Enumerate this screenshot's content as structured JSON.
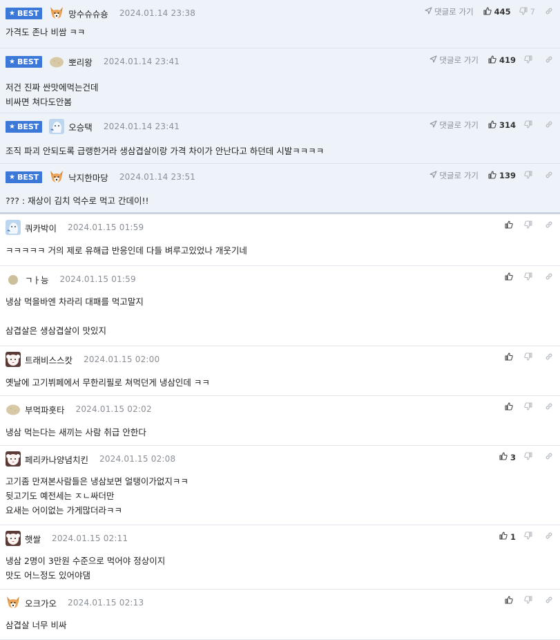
{
  "labels": {
    "best": "BEST",
    "goto": "댓글로 가기"
  },
  "colors": {
    "best_bg": "#eef3f9",
    "best_badge": "#3c78d8",
    "muted": "#8a8f96"
  },
  "comments": [
    {
      "best": true,
      "avatar": "shiba",
      "nick": "망수슈슈숑",
      "date": "2024.01.14 23:38",
      "likes": "445",
      "dislikes": "7",
      "text": "가격도 존나 비쌈 ㅋㅋ"
    },
    {
      "best": true,
      "avatar": "potato",
      "nick": "뽀리왕",
      "date": "2024.01.14 23:41",
      "likes": "419",
      "dislikes": "",
      "text": "저건 진짜 싼맛에먹는건데\n비싸면 쳐다도안봄"
    },
    {
      "best": true,
      "avatar": "ghost",
      "nick": "오승택",
      "date": "2024.01.14 23:41",
      "likes": "314",
      "dislikes": "",
      "text": "조직 파괴 안되도록 급랭한거라 생삼겹살이랑 가격 차이가 안난다고 하던데 시발ㅋㅋㅋㅋ"
    },
    {
      "best": true,
      "avatar": "shiba",
      "nick": "낙지한마당",
      "date": "2024.01.14 23:51",
      "likes": "139",
      "dislikes": "",
      "text": "??? : 재상이 김치 억수로 먹고 간데이!!"
    },
    {
      "best": false,
      "avatar": "ghost",
      "nick": "쿼카박이",
      "date": "2024.01.15 01:59",
      "likes": "",
      "dislikes": "",
      "text": "ㅋㅋㅋㅋㅋ 거의 제로 유해급 반응인데 다들 벼루고있었나 개웃기네"
    },
    {
      "best": false,
      "avatar": "potato-small",
      "nick": "ㄱㅏ능",
      "date": "2024.01.15 01:59",
      "likes": "",
      "dislikes": "",
      "text": "냉삼 먹을바엔 차라리 대패를 먹고말지\n\n삼겹살은 생삼겹살이 맛있지"
    },
    {
      "best": false,
      "avatar": "dog",
      "nick": "트래비스스캇",
      "date": "2024.01.15 02:00",
      "likes": "",
      "dislikes": "",
      "text": "옛날에 고기뷔페에서 무한리필로 쳐먹던게 냉삼인데 ㅋㅋ"
    },
    {
      "best": false,
      "avatar": "potato",
      "nick": "부먹파훗타",
      "date": "2024.01.15 02:02",
      "likes": "",
      "dislikes": "",
      "text": "냉삼 먹는다는 새끼는 사람 취급 안한다"
    },
    {
      "best": false,
      "avatar": "dog",
      "nick": "페리카나양념치킨",
      "date": "2024.01.15 02:08",
      "likes": "3",
      "dislikes": "",
      "text": "고기좀 만져본사람들은 냉삼보면 얼탱이가없지ㅋㅋ\n뒷고기도 예전세는 ㅈㄴ싸더만\n요새는 어이없는 가게많더라ㅋㅋ"
    },
    {
      "best": false,
      "avatar": "dog",
      "nick": "햇쌀",
      "date": "2024.01.15 02:11",
      "likes": "1",
      "dislikes": "",
      "text": "냉삼 2명이 3만원 수준으로 먹어야 정상이지\n맛도 어느정도 있어야댐"
    },
    {
      "best": false,
      "avatar": "shiba",
      "nick": "오크가오",
      "date": "2024.01.15 02:13",
      "likes": "",
      "dislikes": "",
      "text": "삼겹살 너무 비싸"
    }
  ]
}
